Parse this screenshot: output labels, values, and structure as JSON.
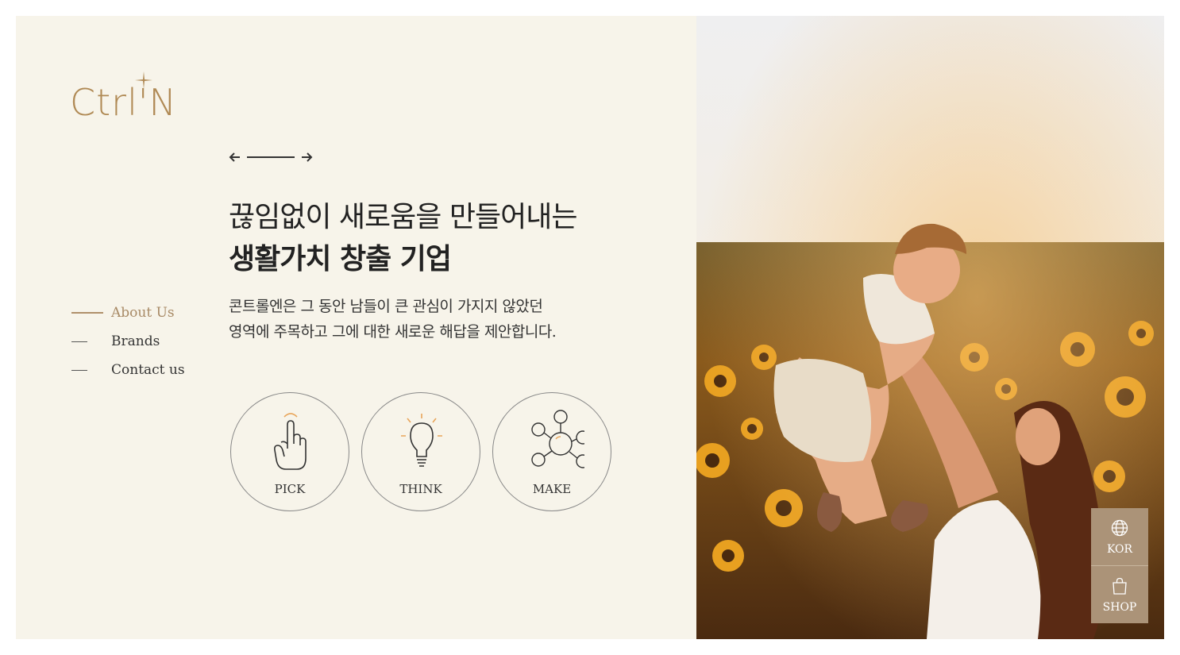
{
  "brand": {
    "logo_text": "Ctrl'N",
    "accent_color": "#b08a55"
  },
  "slide_nav": {
    "prev_icon": "arrow-left-icon",
    "next_icon": "arrow-right-icon"
  },
  "headline": {
    "line1": "끊임없이 새로움을 만들어내는",
    "line2": "생활가치 창출 기업"
  },
  "description": {
    "line1": "콘트롤엔은 그 동안 남들이 큰 관심이 가지지 않았던",
    "line2": "영역에 주목하고 그에 대한 새로운 해답을 제안합니다."
  },
  "side_menu": {
    "items": [
      {
        "label": "About Us",
        "active": true
      },
      {
        "label": "Brands",
        "active": false
      },
      {
        "label": "Contact us",
        "active": false
      }
    ]
  },
  "features": [
    {
      "label": "PICK",
      "icon": "pointing-hand-icon"
    },
    {
      "label": "THINK",
      "icon": "lightbulb-icon"
    },
    {
      "label": "MAKE",
      "icon": "network-icon"
    }
  ],
  "utility": {
    "language_label": "KOR",
    "language_icon": "globe-icon",
    "shop_label": "SHOP",
    "shop_icon": "shopping-bag-icon",
    "background_color": "#ab9378"
  },
  "hero_image": {
    "icon": "sunflower-field-photo"
  }
}
